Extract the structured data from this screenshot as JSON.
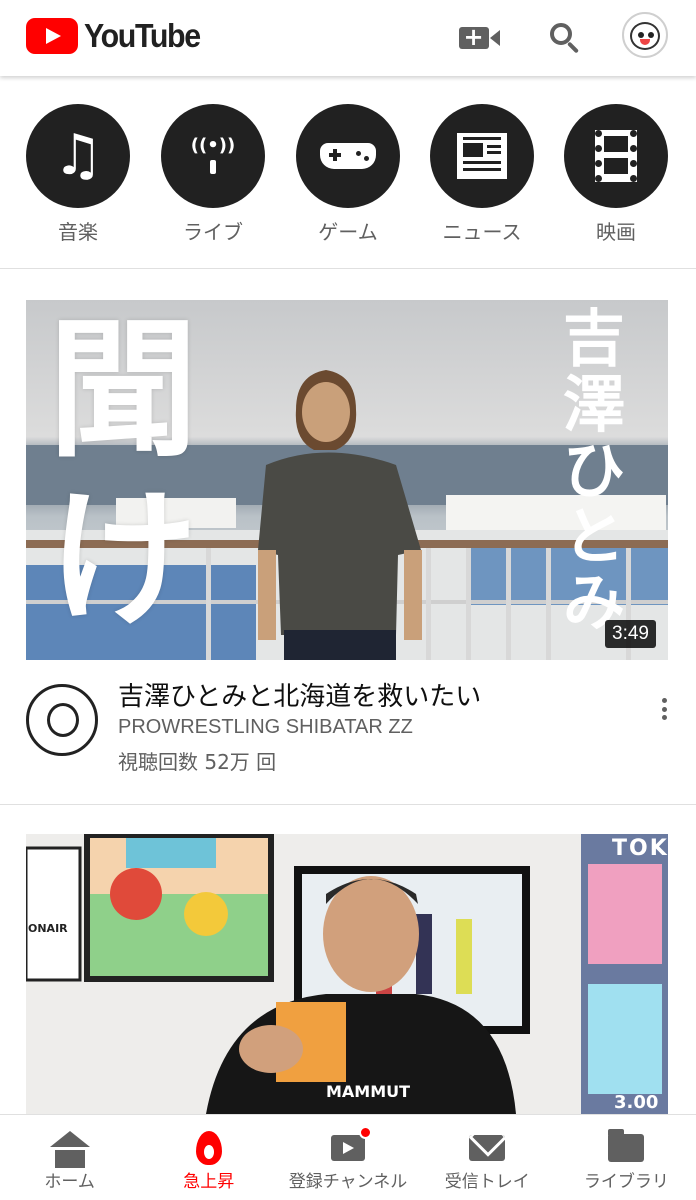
{
  "header": {
    "logo_text": "YouTube",
    "icons": [
      "video-camera-add-icon",
      "search-icon",
      "account-avatar"
    ]
  },
  "categories": [
    {
      "label": "音楽",
      "icon": "music-note-icon"
    },
    {
      "label": "ライブ",
      "icon": "live-broadcast-icon"
    },
    {
      "label": "ゲーム",
      "icon": "gamepad-icon"
    },
    {
      "label": "ニュース",
      "icon": "newspaper-icon"
    },
    {
      "label": "映画",
      "icon": "film-icon"
    }
  ],
  "videos": [
    {
      "title": "吉澤ひとみと北海道を救いたい",
      "channel": "PROWRESTLING SHIBATAR ZZ",
      "views": "視聴回数 52万 回",
      "duration": "3:49",
      "thumb_text_left": [
        "聞",
        "け"
      ],
      "thumb_text_right": [
        "吉",
        "澤",
        "ひ",
        "と",
        "み"
      ]
    },
    {
      "thumb_texts": [
        "ONAIR",
        "MAMMUT",
        "TOK",
        "3.00"
      ]
    }
  ],
  "bottom_nav": [
    {
      "label": "ホーム",
      "icon": "home-icon",
      "active": false
    },
    {
      "label": "急上昇",
      "icon": "trending-fire-icon",
      "active": true
    },
    {
      "label": "登録チャンネル",
      "icon": "subscriptions-icon",
      "active": false
    },
    {
      "label": "受信トレイ",
      "icon": "inbox-mail-icon",
      "active": false
    },
    {
      "label": "ライブラリ",
      "icon": "library-folder-icon",
      "active": false
    }
  ],
  "colors": {
    "brand_red": "#ff0000",
    "icon_gray": "#606060",
    "category_circle": "#212121"
  }
}
